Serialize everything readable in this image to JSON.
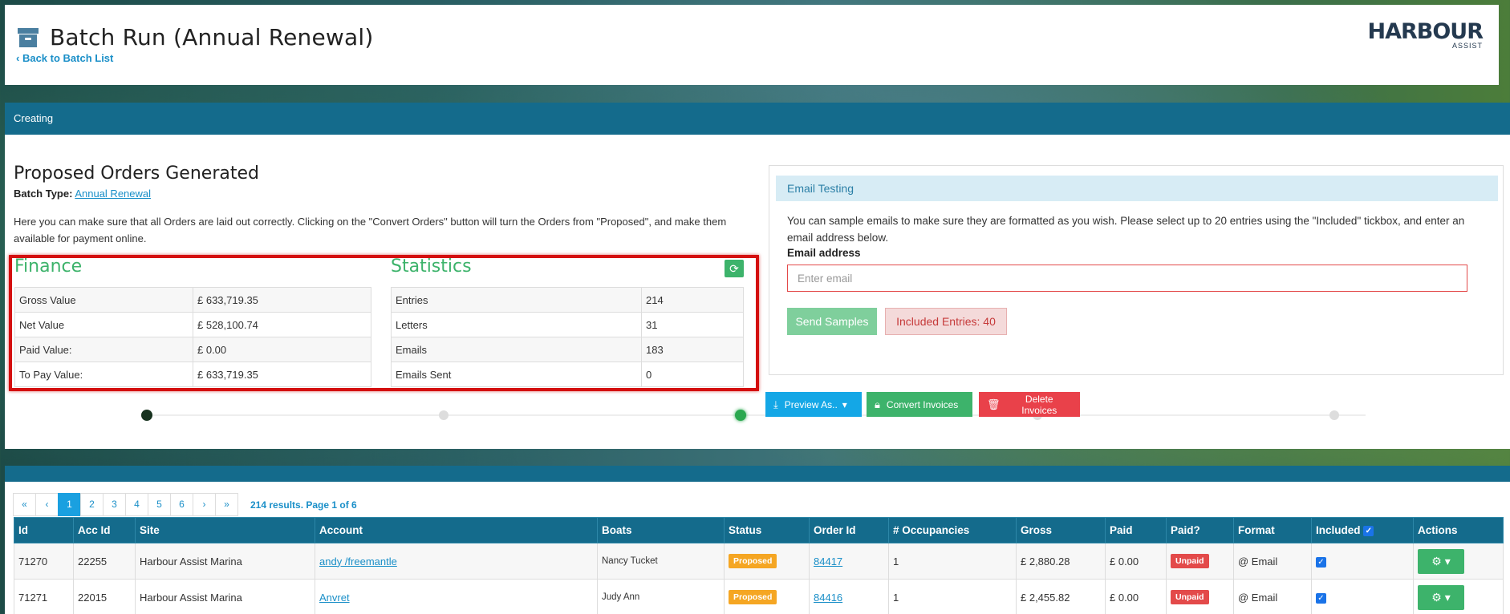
{
  "header": {
    "title": "Batch Run (Annual Renewal)",
    "back_link": "Back to Batch List",
    "logo_main": "HARBOUR",
    "logo_sub": "ASSIST"
  },
  "status_bar": {
    "label": "Creating"
  },
  "summary": {
    "title": "Proposed Orders Generated",
    "batch_type_label": "Batch Type:",
    "batch_type_value": "Annual Renewal",
    "intro": "Here you can make sure that all Orders are laid out correctly. Clicking on the \"Convert Orders\" button will turn the Orders from \"Proposed\", and make them available for payment online."
  },
  "finance": {
    "title": "Finance",
    "rows": [
      {
        "label": "Gross Value",
        "value": "£ 633,719.35"
      },
      {
        "label": "Net Value",
        "value": "£ 528,100.74"
      },
      {
        "label": "Paid Value:",
        "value": "£ 0.00"
      },
      {
        "label": "To Pay Value:",
        "value": "£ 633,719.35"
      }
    ]
  },
  "statistics": {
    "title": "Statistics",
    "rows": [
      {
        "label": "Entries",
        "value": "214"
      },
      {
        "label": "Letters",
        "value": "31"
      },
      {
        "label": "Emails",
        "value": "183"
      },
      {
        "label": "Emails Sent",
        "value": "0"
      }
    ]
  },
  "email_testing": {
    "title": "Email Testing",
    "description": "You can sample emails to make sure they are formatted as you wish. Please select up to 20 entries using the \"Included\" tickbox, and enter an email address below.",
    "email_label": "Email address",
    "email_placeholder": "Enter email",
    "send_button": "Send Samples",
    "included_entries": "Included Entries: 40"
  },
  "actions": {
    "preview": "Preview As..",
    "convert": "Convert Invoices",
    "delete": "Delete Invoices"
  },
  "pagination": {
    "first": "«",
    "prev": "‹",
    "pages": [
      "1",
      "2",
      "3",
      "4",
      "5",
      "6"
    ],
    "next": "›",
    "last": "»",
    "active_page": "1",
    "results": "214 results. Page 1 of 6"
  },
  "orders": {
    "columns": [
      "Id",
      "Acc Id",
      "Site",
      "Account",
      "Boats",
      "Status",
      "Order Id",
      "# Occupancies",
      "Gross",
      "Paid",
      "Paid?",
      "Format",
      "Included",
      "Actions"
    ],
    "rows": [
      {
        "id": "71270",
        "acc_id": "22255",
        "site": "Harbour Assist Marina",
        "account": "andy /freemantle",
        "boats": "Nancy Tucket",
        "status": "Proposed",
        "order_id": "84417",
        "occupancies": "1",
        "gross": "£ 2,880.28",
        "paid": "£ 0.00",
        "paid_status": "Unpaid",
        "format": "@ Email",
        "included": true
      },
      {
        "id": "71271",
        "acc_id": "22015",
        "site": "Harbour Assist Marina",
        "account": "Anvret",
        "boats": "Judy Ann",
        "status": "Proposed",
        "order_id": "84416",
        "occupancies": "1",
        "gross": "£ 2,455.82",
        "paid": "£ 0.00",
        "paid_status": "Unpaid",
        "format": "@ Email",
        "included": true
      }
    ]
  },
  "colors": {
    "primary_bar": "#146b8c",
    "success": "#3db36b",
    "danger": "#e9414a",
    "info": "#14a7e6",
    "warning": "#f5a623",
    "link": "#1a8fc8"
  },
  "icons": [
    "archive-icon",
    "chevron-left-icon",
    "refresh-icon",
    "download-icon",
    "caret-down-icon",
    "lock-icon",
    "trash-icon",
    "gear-icon",
    "checkbox-icon"
  ]
}
